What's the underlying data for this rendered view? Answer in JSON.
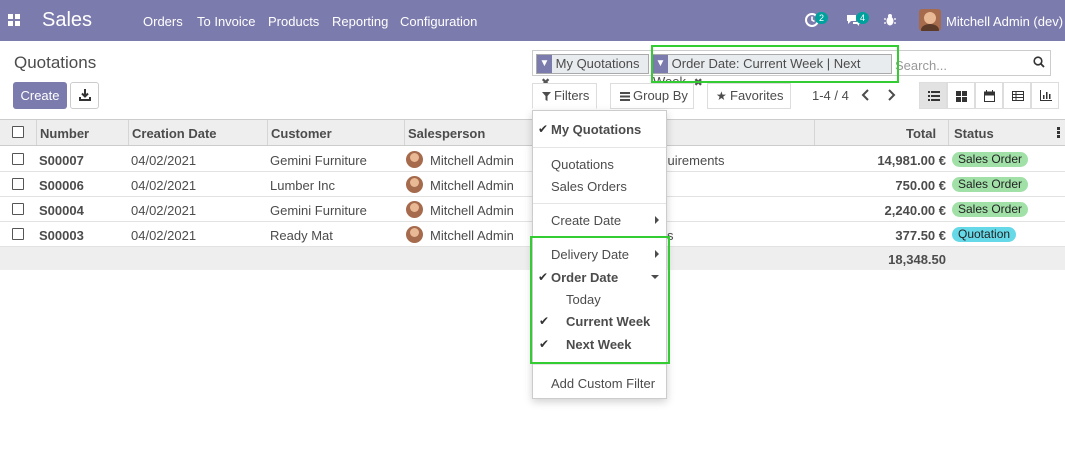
{
  "navbar": {
    "brand": "Sales",
    "menu": [
      "Orders",
      "To Invoice",
      "Products",
      "Reporting",
      "Configuration"
    ],
    "activity_count": "2",
    "messages_count": "4",
    "user": "Mitchell Admin (dev)"
  },
  "page": {
    "title": "Quotations",
    "create_label": "Create"
  },
  "search": {
    "facets": [
      "My Quotations",
      "Order Date: Current Week | Next Week"
    ],
    "placeholder": "Search..."
  },
  "toolbar": {
    "filters_label": "Filters",
    "groupby_label": "Group By",
    "favorites_label": "Favorites",
    "pager": "1-4 / 4"
  },
  "table": {
    "columns": [
      "Number",
      "Creation Date",
      "Customer",
      "Salesperson",
      "Total",
      "Status"
    ],
    "rows": [
      {
        "number": "S00007",
        "date": "04/02/2021",
        "customer": "Gemini Furniture",
        "salesperson": "Mitchell Admin",
        "extra": "equirements",
        "total": "14,981.00 €",
        "status": "Sales Order"
      },
      {
        "number": "S00006",
        "date": "04/02/2021",
        "customer": "Lumber Inc",
        "salesperson": "Mitchell Admin",
        "extra": "",
        "total": "750.00 €",
        "status": "Sales Order"
      },
      {
        "number": "S00004",
        "date": "04/02/2021",
        "customer": "Gemini Furniture",
        "salesperson": "Mitchell Admin",
        "extra": "",
        "total": "2,240.00 €",
        "status": "Sales Order"
      },
      {
        "number": "S00003",
        "date": "04/02/2021",
        "customer": "Ready Mat",
        "salesperson": "Mitchell Admin",
        "extra": "s",
        "total": "377.50 €",
        "status": "Quotation"
      }
    ],
    "grand_total": "18,348.50"
  },
  "filters_menu": {
    "my_quotations": "My Quotations",
    "quotations": "Quotations",
    "sales_orders": "Sales Orders",
    "create_date": "Create Date",
    "delivery_date": "Delivery Date",
    "order_date": "Order Date",
    "today": "Today",
    "current_week": "Current Week",
    "next_week": "Next Week",
    "add_custom_filter": "Add Custom Filter"
  },
  "colors": {
    "brand": "#7c7bad",
    "status_sales_order": "#a1e1a8",
    "status_quotation": "#66d9e8",
    "highlight": "#33cc33"
  }
}
